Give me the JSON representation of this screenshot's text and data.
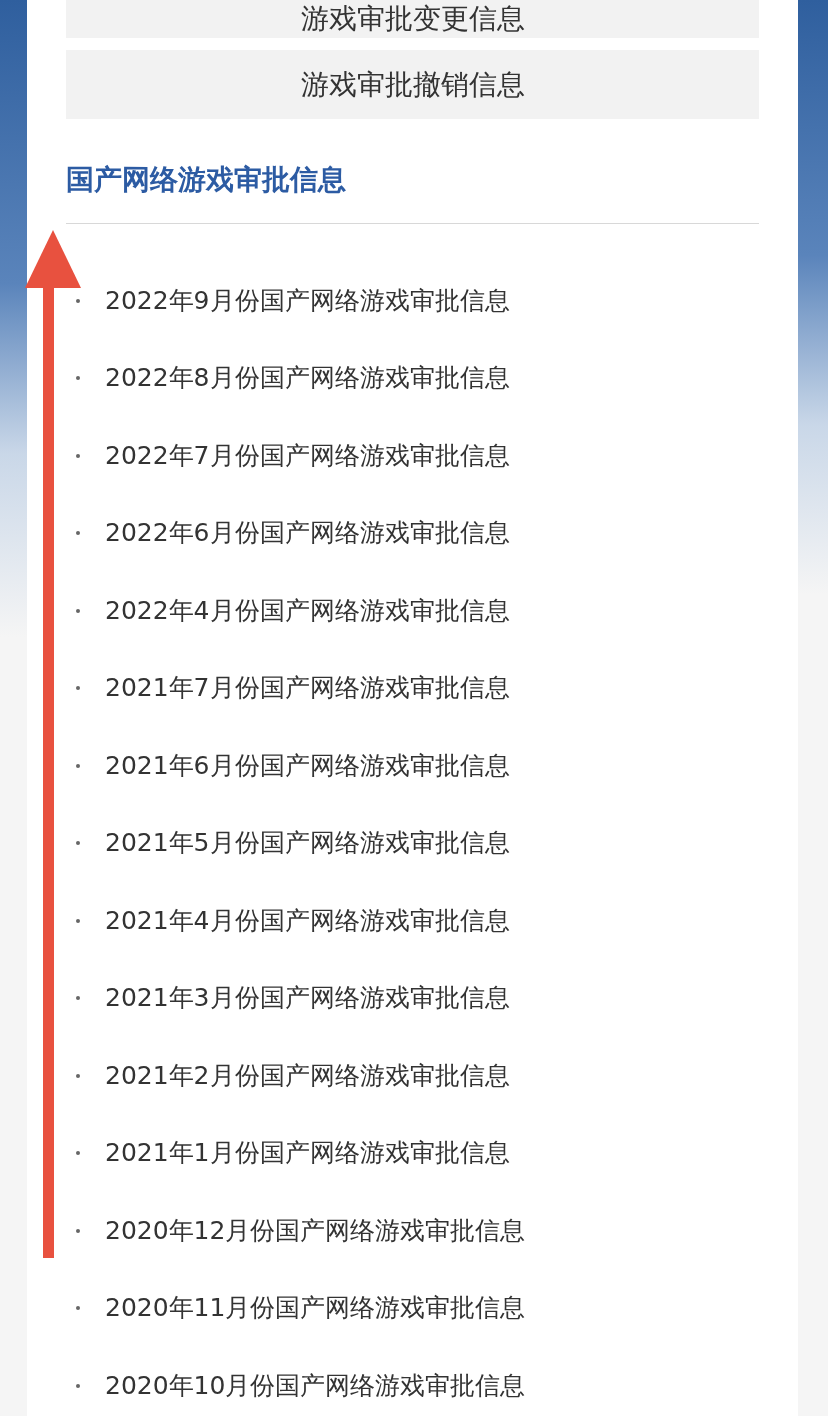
{
  "buttons": [
    "游戏审批变更信息",
    "游戏审批撤销信息"
  ],
  "section": {
    "title": "国产网络游戏审批信息",
    "items": [
      "2022年9月份国产网络游戏审批信息",
      "2022年8月份国产网络游戏审批信息",
      "2022年7月份国产网络游戏审批信息",
      "2022年6月份国产网络游戏审批信息",
      "2022年4月份国产网络游戏审批信息",
      "2021年7月份国产网络游戏审批信息",
      "2021年6月份国产网络游戏审批信息",
      "2021年5月份国产网络游戏审批信息",
      "2021年4月份国产网络游戏审批信息",
      "2021年3月份国产网络游戏审批信息",
      "2021年2月份国产网络游戏审批信息",
      "2021年1月份国产网络游戏审批信息",
      "2020年12月份国产网络游戏审批信息",
      "2020年11月份国产网络游戏审批信息",
      "2020年10月份国产网络游戏审批信息"
    ]
  }
}
